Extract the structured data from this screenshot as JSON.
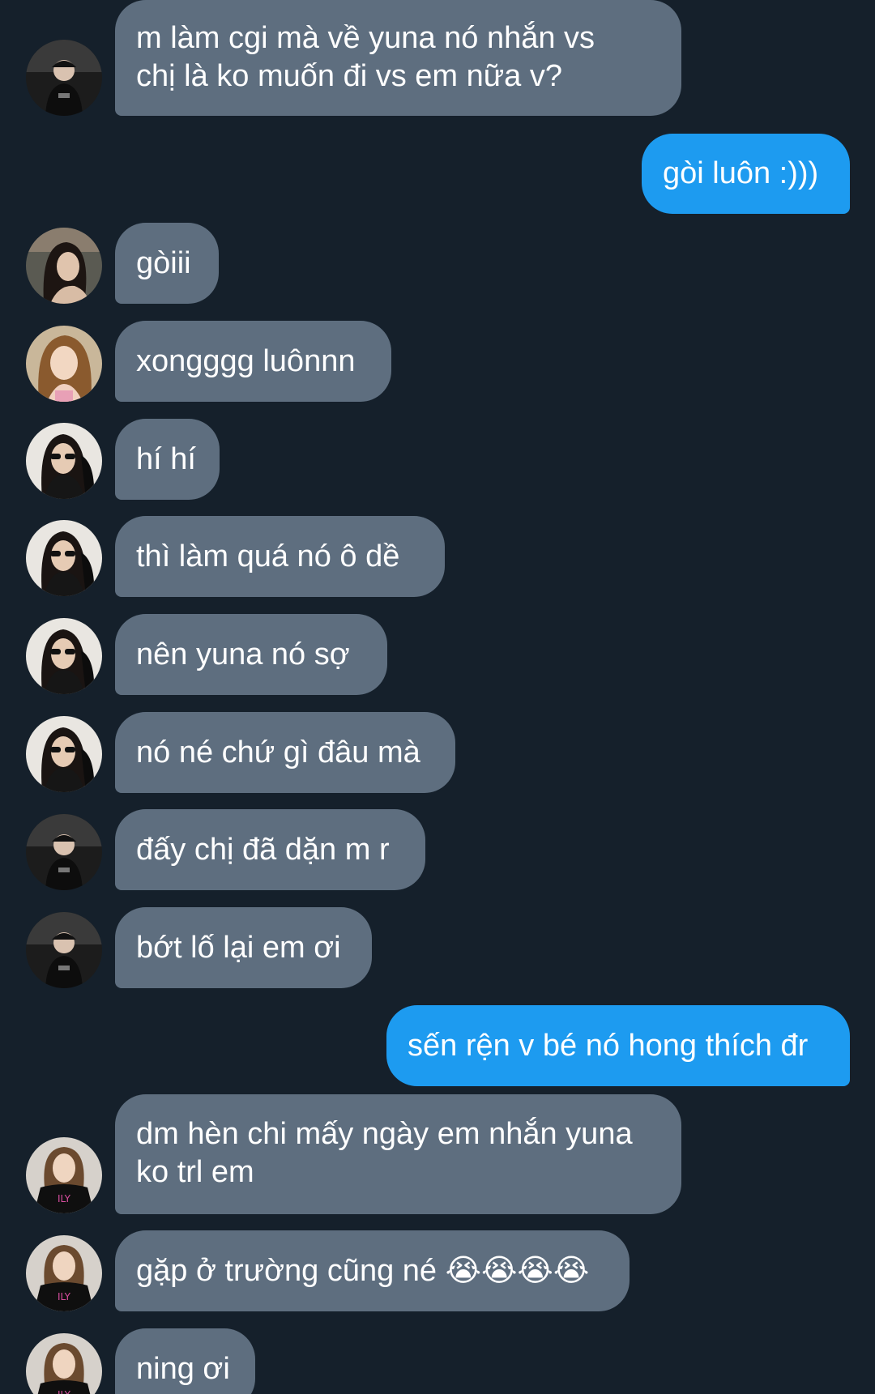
{
  "conversation": {
    "messages": [
      {
        "side": "in",
        "avatar": "avatar-dark-cap",
        "text": "m làm cgi mà về yuna nó nhắn vs\nchị là ko muốn đi vs em nữa v?"
      },
      {
        "side": "out",
        "text": "gòi luôn :)))"
      },
      {
        "side": "in",
        "avatar": "avatar-portrait-a",
        "text": "gòiii"
      },
      {
        "side": "in",
        "avatar": "avatar-portrait-b",
        "text": "xongggg luônnn"
      },
      {
        "side": "in",
        "avatar": "avatar-sunglasses",
        "text": "hí hí"
      },
      {
        "side": "in",
        "avatar": "avatar-sunglasses",
        "text": "thì làm quá nó ô dề"
      },
      {
        "side": "in",
        "avatar": "avatar-sunglasses",
        "text": "nên yuna nó sợ"
      },
      {
        "side": "in",
        "avatar": "avatar-sunglasses",
        "text": "nó né chứ gì đâu mà"
      },
      {
        "side": "in",
        "avatar": "avatar-dark-cap",
        "text": "đấy chị đã dặn m r"
      },
      {
        "side": "in",
        "avatar": "avatar-dark-cap",
        "text": "bớt lố lại em ơi"
      },
      {
        "side": "out",
        "text": "sến rện v bé nó hong thích đr"
      },
      {
        "side": "in",
        "avatar": "avatar-crop-top",
        "text": "dm hèn chi mấy ngày em nhắn yuna\nko trl em"
      },
      {
        "side": "in",
        "avatar": "avatar-crop-top",
        "text": "gặp ở trường cũng né 😭😭😭😭"
      },
      {
        "side": "in",
        "avatar": "avatar-crop-top",
        "text": "ning ơi"
      }
    ]
  },
  "colors": {
    "background": "#15202b",
    "incoming_bubble": "#5e6e7f",
    "outgoing_bubble": "#1d9bf0",
    "text": "#ffffff"
  }
}
